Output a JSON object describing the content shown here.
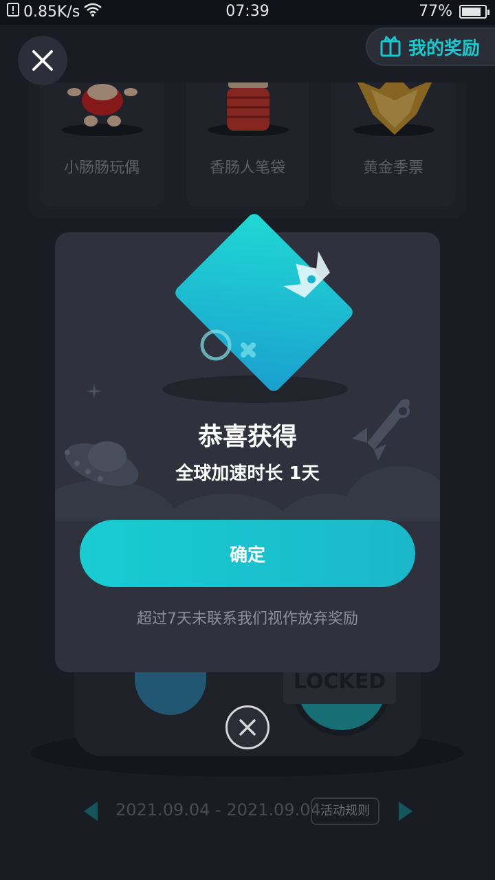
{
  "status_bar": {
    "speed": "0.85K/s",
    "time": "07:39",
    "battery": "77%"
  },
  "header": {
    "rewards_label": "我的奖励"
  },
  "prizes": [
    {
      "label": "小肠肠玩偶"
    },
    {
      "label": "香肠人笔袋"
    },
    {
      "label": "黄金季票"
    }
  ],
  "machine": {
    "locked_label": "LOCKED"
  },
  "date_bar": {
    "range": "2021.09.04 - 2021.09.04",
    "rules_label": "活动规则"
  },
  "modal": {
    "title": "恭喜获得",
    "subtitle": "全球加速时长 1天",
    "confirm_label": "确定",
    "note": "超过7天未联系我们视作放弃奖励"
  },
  "colors": {
    "accent": "#18c9cf",
    "modal_bg": "#2f323d",
    "page_bg": "#22252f"
  },
  "icons": [
    "close-icon",
    "gift-box-icon",
    "wifi-icon",
    "battery-icon",
    "chevron-left-icon",
    "chevron-right-icon",
    "crown-icon",
    "rocket-icon",
    "ufo-icon"
  ]
}
